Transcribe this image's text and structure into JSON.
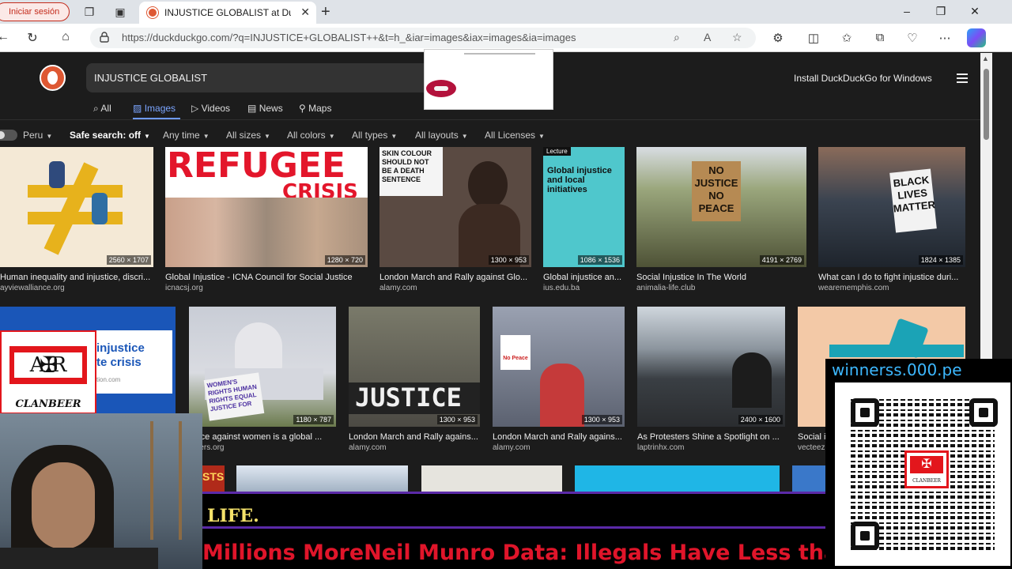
{
  "browser": {
    "profile_label": "Iniciar sesión",
    "tab_title": "INJUSTICE GLOBALIST at DuckDu",
    "url_host": "https://duckduckgo.com",
    "url_path": "/?q=INJUSTICE+GLOBALIST++&t=h_&iar=images&iax=images&ia=images"
  },
  "header": {
    "search_value": "INJUSTICE GLOBALIST",
    "install_label": "Install DuckDuckGo for Windows"
  },
  "nav": {
    "tabs": [
      {
        "label": "All",
        "icon": "search-icon"
      },
      {
        "label": "Images",
        "icon": "image-icon",
        "active": true
      },
      {
        "label": "Videos",
        "icon": "play-icon"
      },
      {
        "label": "News",
        "icon": "news-icon"
      },
      {
        "label": "Maps",
        "icon": "pin-icon"
      }
    ]
  },
  "filters": {
    "region": "Peru",
    "safe_search": "Safe search: off",
    "time": "Any time",
    "sizes": "All sizes",
    "colors": "All colors",
    "types": "All types",
    "layouts": "All layouts",
    "licenses": "All Licenses"
  },
  "row1": [
    {
      "caption": "Human inequality and injustice, discri...",
      "source": "ayviewalliance.org",
      "dims": "2560 × 1707",
      "bg": "#f4e9d6"
    },
    {
      "caption": "Global Injustice - ICNA Council for Social Justice",
      "source": "icnacsj.org",
      "dims": "1280 × 720",
      "bg": "#ffffff",
      "big1": "REFUGEE",
      "big2": "CRISIS"
    },
    {
      "caption": "London March and Rally against Glo...",
      "source": "alamy.com",
      "dims": "1300 × 953",
      "bg": "#5a4a42",
      "sign": "SKIN COLOUR SHOULD NOT BE A DEATH SENTENCE"
    },
    {
      "caption": "Global injustice an...",
      "source": "ius.edu.ba",
      "dims": "1086 × 1536",
      "bg": "#4fc7cc",
      "label": "Lecture",
      "heading": "Global injustice and local initiatives"
    },
    {
      "caption": "Social Injustice In The World",
      "source": "animalia-life.club",
      "dims": "4191 × 2769",
      "bg": "#6f7a58",
      "sign": "NO JUSTICE NO PEACE"
    },
    {
      "caption": "What can I do to fight injustice duri...",
      "source": "wearememphis.com",
      "dims": "1824 × 1385",
      "bg": "#3a4350",
      "sign": "BLACK LIVES MATTER"
    }
  ],
  "row2": [
    {
      "caption": "",
      "source": "",
      "dims": "",
      "bg": "#1a56b8",
      "heading1": "injustice",
      "heading2": "te crisis",
      "sub": "tion.com"
    },
    {
      "caption": "lence against women is a global ...",
      "source": "elders.org",
      "dims": "1180 × 787",
      "bg": "#c9cdd6",
      "sign": "WOMEN'S RIGHTS HUMAN RIGHTS EQUAL JUSTICE FOR"
    },
    {
      "caption": "London March and Rally agains...",
      "source": "alamy.com",
      "dims": "1300 × 953",
      "bg": "#4c4a44",
      "big1": "JUSTICE"
    },
    {
      "caption": "London March and Rally agains...",
      "source": "alamy.com",
      "dims": "1300 × 953",
      "bg": "#5b6170",
      "sign": "No Peace"
    },
    {
      "caption": "As Protesters Shine a Spotlight on ...",
      "source": "laptrinhx.com",
      "dims": "2400 × 1600",
      "bg": "#5c636b"
    },
    {
      "caption": "Social i",
      "source": "vecteez",
      "dims": "",
      "bg": "#f3c9a7"
    }
  ],
  "row3_label": "STS",
  "overlays": {
    "badge_text": "CLANBEER",
    "badge_letters": "A R",
    "ticker_line1": "LIFE.",
    "ticker_line2": "Millions MoreNeil Munro Data: Illegals Have Less than",
    "qr_title": "winnerss.000.pe",
    "qr_logo_text": "CLANBEER"
  }
}
